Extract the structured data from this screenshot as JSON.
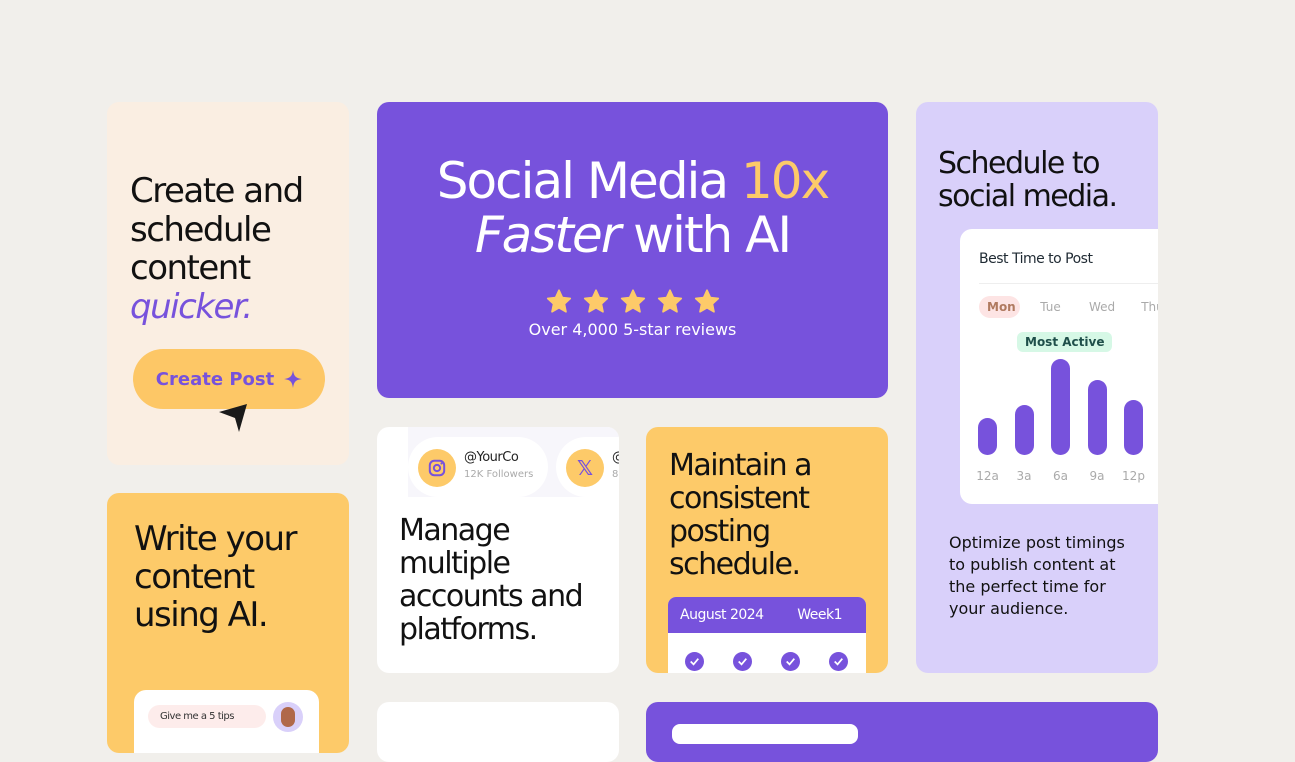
{
  "colors": {
    "purple": "#7752dc",
    "yellow": "#fdca69",
    "beige": "#faeee2",
    "lavender": "#d9d0fa",
    "background": "#f1efeb"
  },
  "card_create": {
    "line1": "Create and",
    "line2": "schedule",
    "line3": "content",
    "accent": "quicker.",
    "button": "Create Post",
    "button_icon": "sparkle-icon",
    "cursor_icon": "cursor-arrow-icon"
  },
  "hero": {
    "line1a": "Social Media ",
    "line1b": "10x",
    "line2a": "Faster",
    "line2b": " with AI",
    "stars": 5,
    "reviews": "Over 4,000 5-star reviews"
  },
  "card_schedule": {
    "title1": "Schedule to",
    "title2": "social media.",
    "widget_title": "Best Time to Post",
    "days": [
      "Mon",
      "Tue",
      "Wed",
      "Thu"
    ],
    "selected_day": "Mon",
    "badge": "Most Active",
    "chart_data": {
      "type": "bar",
      "categories": [
        "12a",
        "3a",
        "6a",
        "9a",
        "12p"
      ],
      "values": [
        37,
        50,
        96,
        75,
        55
      ]
    },
    "description": "Optimize post timings to publish content at the perfect time for your audience."
  },
  "card_accounts": {
    "accounts": [
      {
        "handle": "@YourCo",
        "followers": "12K Followers",
        "icon": "instagram-icon"
      },
      {
        "handle": "@",
        "followers": "8",
        "icon": "x-icon"
      }
    ],
    "text": "Manage multiple accounts and platforms."
  },
  "card_consistent": {
    "text": "Maintain a consistent posting schedule.",
    "calendar_month": "August 2024",
    "calendar_week": "Week1",
    "checks": 4
  },
  "card_write": {
    "line1": "Write your",
    "line2": "content",
    "line3": "using AI.",
    "chat": "Give me a 5 tips"
  }
}
